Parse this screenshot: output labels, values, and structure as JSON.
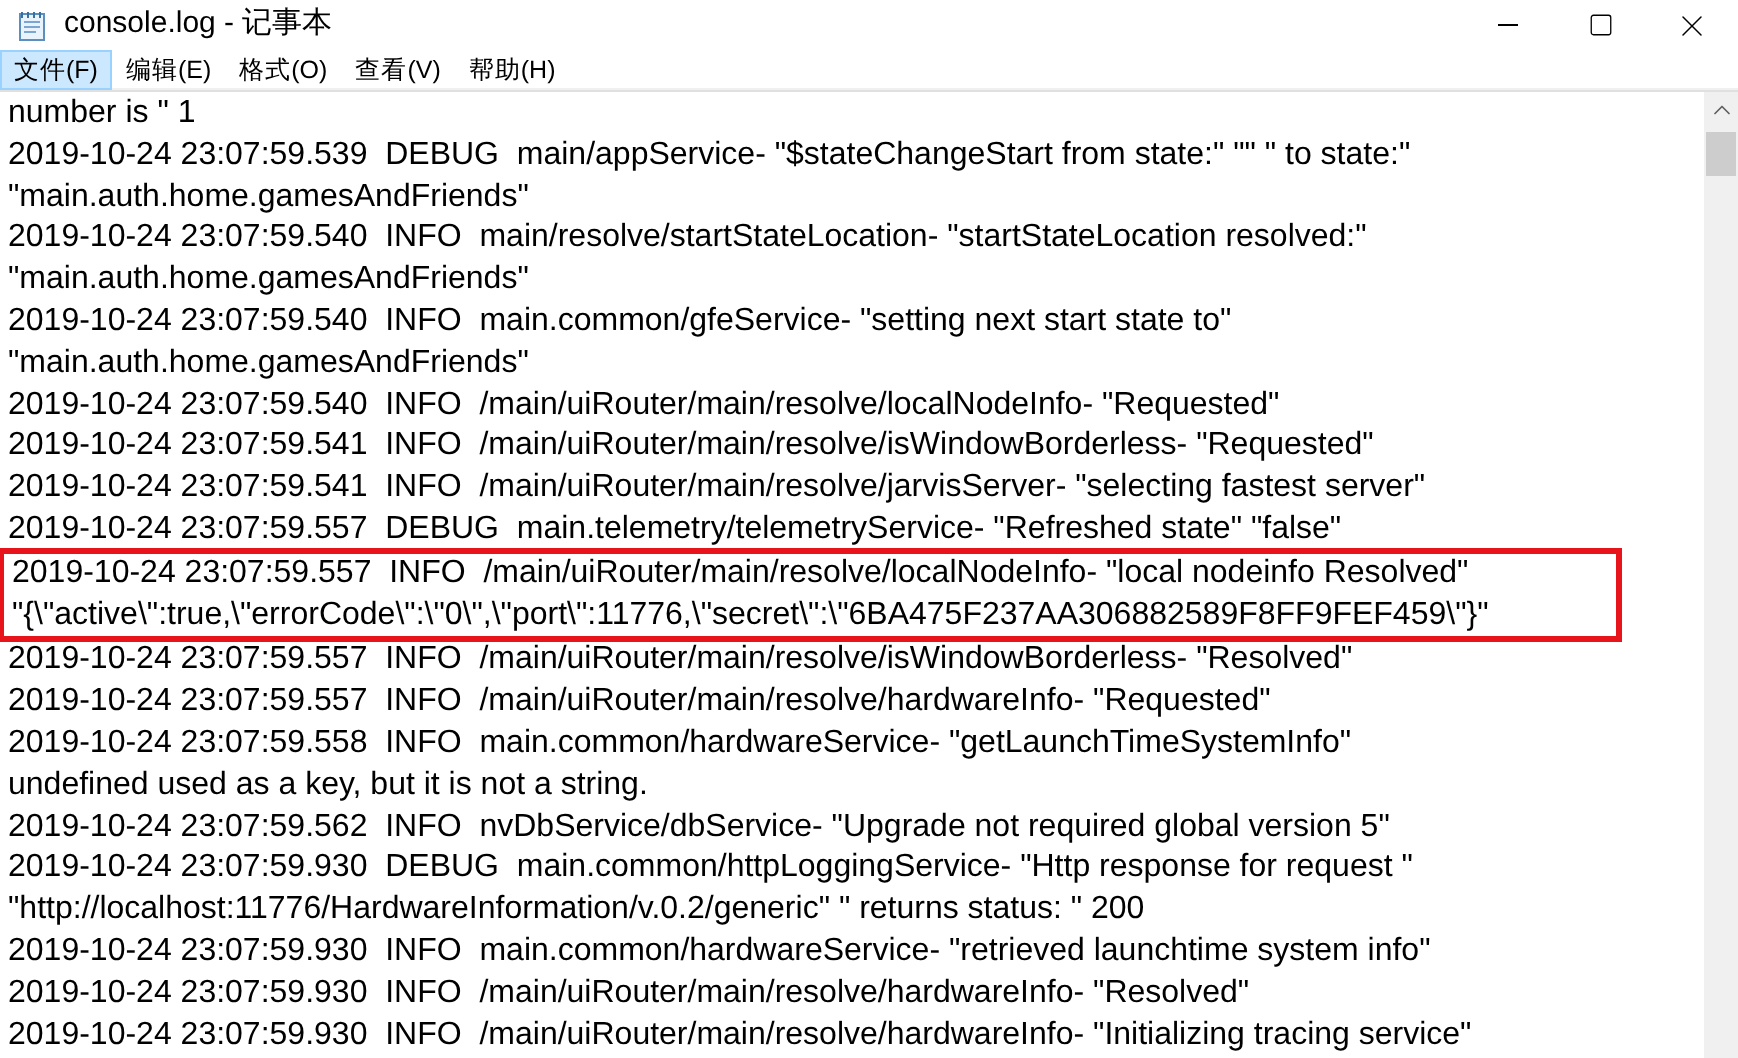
{
  "window": {
    "title": "console.log - 记事本"
  },
  "menu": [
    {
      "label": "文件(F)",
      "selected": true
    },
    {
      "label": "编辑(E)",
      "selected": false
    },
    {
      "label": "格式(O)",
      "selected": false
    },
    {
      "label": "查看(V)",
      "selected": false
    },
    {
      "label": "帮助(H)",
      "selected": false
    }
  ],
  "lines": [
    {
      "text": "number is \" 1",
      "highlighted": false
    },
    {
      "text": "2019-10-24 23:07:59.539  DEBUG  main/appService- \"$stateChangeStart from state:\" \"\" \" to state:\"",
      "highlighted": false
    },
    {
      "text": "\"main.auth.home.gamesAndFriends\"",
      "highlighted": false
    },
    {
      "text": "2019-10-24 23:07:59.540  INFO  main/resolve/startStateLocation- \"startStateLocation resolved:\"",
      "highlighted": false
    },
    {
      "text": "\"main.auth.home.gamesAndFriends\"",
      "highlighted": false
    },
    {
      "text": "2019-10-24 23:07:59.540  INFO  main.common/gfeService- \"setting next start state to\"",
      "highlighted": false
    },
    {
      "text": "\"main.auth.home.gamesAndFriends\"",
      "highlighted": false
    },
    {
      "text": "2019-10-24 23:07:59.540  INFO  /main/uiRouter/main/resolve/localNodeInfo- \"Requested\"",
      "highlighted": false
    },
    {
      "text": "2019-10-24 23:07:59.541  INFO  /main/uiRouter/main/resolve/isWindowBorderless- \"Requested\"",
      "highlighted": false
    },
    {
      "text": "2019-10-24 23:07:59.541  INFO  /main/uiRouter/main/resolve/jarvisServer- \"selecting fastest server\"",
      "highlighted": false
    },
    {
      "text": "2019-10-24 23:07:59.557  DEBUG  main.telemetry/telemetryService- \"Refreshed state\" \"false\"",
      "highlighted": false
    },
    {
      "text": "2019-10-24 23:07:59.557  INFO  /main/uiRouter/main/resolve/localNodeInfo- \"local nodeinfo Resolved\"",
      "highlighted": true
    },
    {
      "text": "\"{\\\"active\\\":true,\\\"errorCode\\\":\\\"0\\\",\\\"port\\\":11776,\\\"secret\\\":\\\"6BA475F237AA306882589F8FF9FEF459\\\"}\"",
      "highlighted": true
    },
    {
      "text": "2019-10-24 23:07:59.557  INFO  /main/uiRouter/main/resolve/isWindowBorderless- \"Resolved\"",
      "highlighted": false
    },
    {
      "text": "2019-10-24 23:07:59.557  INFO  /main/uiRouter/main/resolve/hardwareInfo- \"Requested\"",
      "highlighted": false
    },
    {
      "text": "2019-10-24 23:07:59.558  INFO  main.common/hardwareService- \"getLaunchTimeSystemInfo\"",
      "highlighted": false
    },
    {
      "text": "undefined used as a key, but it is not a string.",
      "highlighted": false
    },
    {
      "text": "2019-10-24 23:07:59.562  INFO  nvDbService/dbService- \"Upgrade not required global version 5\"",
      "highlighted": false
    },
    {
      "text": "2019-10-24 23:07:59.930  DEBUG  main.common/httpLoggingService- \"Http response for request \"",
      "highlighted": false
    },
    {
      "text": "\"http://localhost:11776/HardwareInformation/v.0.2/generic\" \" returns status: \" 200",
      "highlighted": false
    },
    {
      "text": "2019-10-24 23:07:59.930  INFO  main.common/hardwareService- \"retrieved launchtime system info\"",
      "highlighted": false
    },
    {
      "text": "2019-10-24 23:07:59.930  INFO  /main/uiRouter/main/resolve/hardwareInfo- \"Resolved\"",
      "highlighted": false
    },
    {
      "text": "2019-10-24 23:07:59.930  INFO  /main/uiRouter/main/resolve/hardwareInfo- \"Initializing tracing service\"",
      "highlighted": false
    }
  ]
}
